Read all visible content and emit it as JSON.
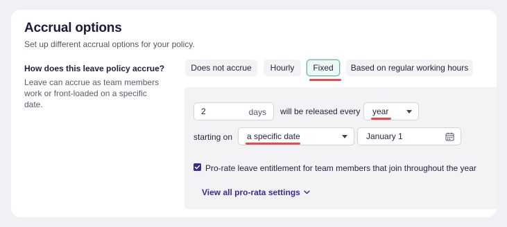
{
  "section": {
    "title": "Accrual options",
    "subtitle": "Set up different accrual options for your policy."
  },
  "question": {
    "label": "How does this leave policy accrue?",
    "help": "Leave can accrue as team members work or front-loaded on a specific date."
  },
  "accrual_options": [
    {
      "label": "Does not accrue",
      "selected": false
    },
    {
      "label": "Hourly",
      "selected": false
    },
    {
      "label": "Fixed",
      "selected": true
    },
    {
      "label": "Based on regular working hours",
      "selected": false
    }
  ],
  "fixed": {
    "amount_value": "2",
    "amount_unit": "days",
    "released_text": "will be released every",
    "period_value": "year",
    "starting_text": "starting on",
    "start_type_value": "a specific date",
    "date_value": "January 1",
    "prorate_checked": true,
    "prorate_label": "Pro-rate leave entitlement for team members that join throughout the year",
    "prorata_link": "View all pro-rata settings"
  },
  "colors": {
    "accent": "#3b2a8f",
    "selected_border": "#5fb4a8",
    "annotation_red": "#e24c4c"
  }
}
